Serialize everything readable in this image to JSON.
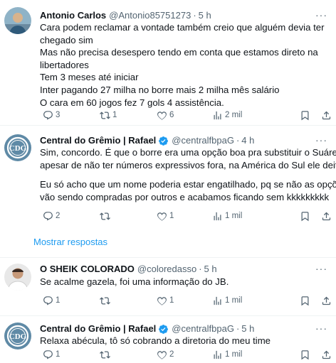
{
  "tweets": [
    {
      "name": "Antonio Carlos",
      "handle": "@Antonio85751273",
      "time": "5 h",
      "verified": false,
      "lines": [
        "Cara podem reclamar a vontade também creio que alguém devia ter",
        "chegado sim",
        "Mas não precisa desespero tendo em conta que estamos direto na",
        "libertadores",
        "Tem 3 meses até iniciar",
        "Inter pagando 27 milha no borre mais 2 milha mês salário",
        "O cara em 60 jogos fez 7 gols 4 assistência."
      ],
      "replies": "3",
      "retweets": "1",
      "likes": "6",
      "views": "2 mil"
    },
    {
      "name": "Central do Grêmio | Rafael",
      "handle": "@centralfbpaG",
      "time": "4 h",
      "verified": true,
      "lines": [
        "Sim, concordo. É que o borre era uma opção boa pra substituir o Suárez,",
        "apesar de não ter números expressivos fora, na América do Sul ele deita.",
        "",
        "Eu só acho que um nome poderia estar engatilhado, pq se não as opções",
        "vão sendo compradas por outros e acabamos ficando sem kkkkkkkkk"
      ],
      "replies": "2",
      "retweets": "",
      "likes": "1",
      "views": "1 mil"
    },
    {
      "name": "O SHEIK COLORADO",
      "handle": "@coloredasso",
      "time": "5 h",
      "verified": false,
      "lines": [
        "Se acalme gazela, foi uma informação do JB."
      ],
      "replies": "1",
      "retweets": "",
      "likes": "1",
      "views": "1 mil"
    },
    {
      "name": "Central do Grêmio | Rafael",
      "handle": "@centralfbpaG",
      "time": "5 h",
      "verified": true,
      "lines": [
        "Relaxa abécula, tô só cobrando a diretoria do meu time"
      ],
      "replies": "1",
      "retweets": "",
      "likes": "2",
      "views": "1 mil"
    }
  ],
  "show_replies_label": "Mostrar respostas",
  "separator": "·",
  "more_label": "···",
  "colors": {
    "accent": "#1d9bf0",
    "text": "#0f1419",
    "muted": "#536471",
    "divider": "#eff3f4",
    "verified": "#1d9bf0"
  },
  "icons": {
    "reply": "speech-bubble-icon",
    "retweet": "retweet-icon",
    "like": "heart-icon",
    "views": "bar-chart-icon",
    "bookmark": "bookmark-icon",
    "share": "share-icon",
    "verified": "verified-badge-icon",
    "more": "more-icon"
  }
}
